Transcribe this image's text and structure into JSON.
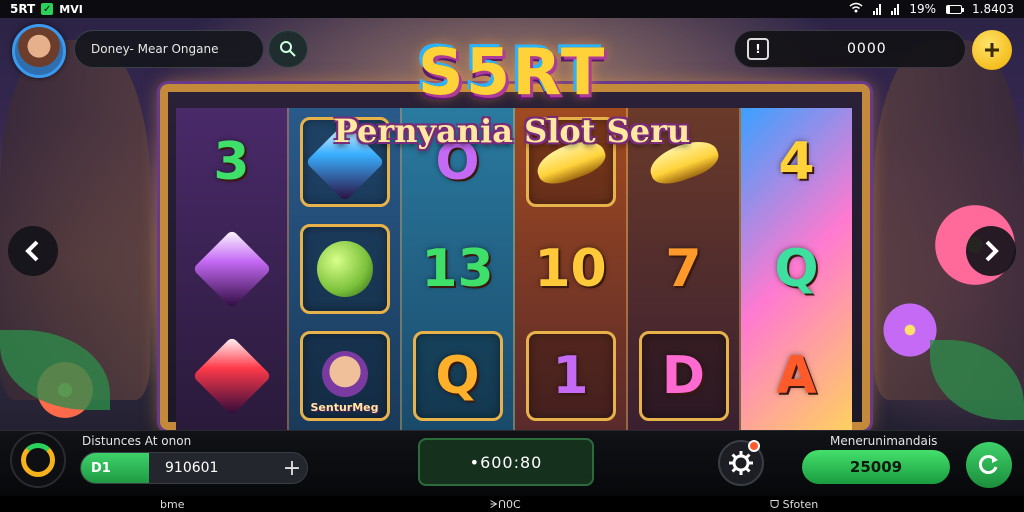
{
  "status_bar": {
    "carrier": "5RT",
    "indicator": "✓",
    "extra": "ⅯⅤⅠ",
    "battery": "19%",
    "time": "1.8403"
  },
  "header": {
    "profile_name": "Doney- Mear Ongane",
    "coin_balance": "0000"
  },
  "logo": {
    "title": "S5RT",
    "subtitle": "Pernyania Slot Seru"
  },
  "reels": [
    {
      "symbols": [
        {
          "type": "text",
          "value": "3",
          "color": "#3ee06a"
        },
        {
          "type": "gem",
          "color": "#c56af5"
        },
        {
          "type": "gem",
          "color": "#ff3a4a"
        }
      ]
    },
    {
      "symbols": [
        {
          "type": "gem",
          "color": "#3ab0ff",
          "boxed": true
        },
        {
          "type": "fruit",
          "color": "#7ac03a",
          "boxed": true
        },
        {
          "type": "portrait",
          "label": "SenturMeg",
          "boxed": true
        }
      ]
    },
    {
      "symbols": [
        {
          "type": "text",
          "value": "O",
          "color": "#c56af5"
        },
        {
          "type": "text",
          "value": "13",
          "color": "#3ee06a"
        },
        {
          "type": "text",
          "value": "Q",
          "color": "#ffb02a",
          "boxed": true
        }
      ]
    },
    {
      "symbols": [
        {
          "type": "banana",
          "color": "#ffd23a",
          "boxed": true
        },
        {
          "type": "text",
          "value": "10",
          "color": "#ffc93a"
        },
        {
          "type": "text",
          "value": "1",
          "color": "#c56af5",
          "boxed": true
        }
      ]
    },
    {
      "symbols": [
        {
          "type": "banana",
          "color": "#ffd23a"
        },
        {
          "type": "text",
          "value": "7",
          "color": "#ff9a2a"
        },
        {
          "type": "text",
          "value": "D",
          "color": "#ff6ad0",
          "boxed": true
        }
      ]
    },
    {
      "symbols": [
        {
          "type": "text",
          "value": "4",
          "color": "#ffd23a"
        },
        {
          "type": "text",
          "value": "Q",
          "color": "#3ee0a0"
        },
        {
          "type": "text",
          "value": "A",
          "color": "#ff5a2a"
        }
      ]
    }
  ],
  "bottom": {
    "left_label": "Distunces At onon",
    "bet_tag": "D1",
    "bet_value": "910601",
    "plus": "+",
    "total": "•600:80",
    "right_label": "Menerunimandais",
    "win_value": "25009"
  },
  "nav": {
    "left": "bme",
    "center": "ᗒᑎ0C",
    "right": "ᗜ Sfoten"
  },
  "colors": {
    "accent_green": "#2bd15a",
    "gold": "#f5b21a",
    "frame": "#c28a3a"
  }
}
